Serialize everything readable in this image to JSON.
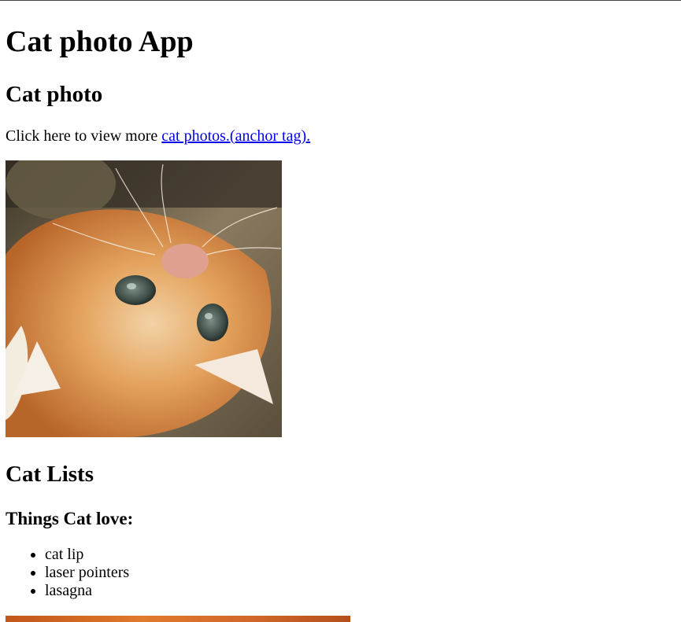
{
  "page": {
    "title": "Cat photo App",
    "section_photo": {
      "heading": "Cat photo",
      "intro_text": "Click here to view more ",
      "link_text": "cat photos.(anchor tag).",
      "image_subject": "orange kitten lying upside down"
    },
    "section_lists": {
      "heading": "Cat Lists",
      "subheading": "Things Cat love:",
      "items": [
        "cat lip",
        "laser pointers",
        "lasagna"
      ]
    }
  }
}
